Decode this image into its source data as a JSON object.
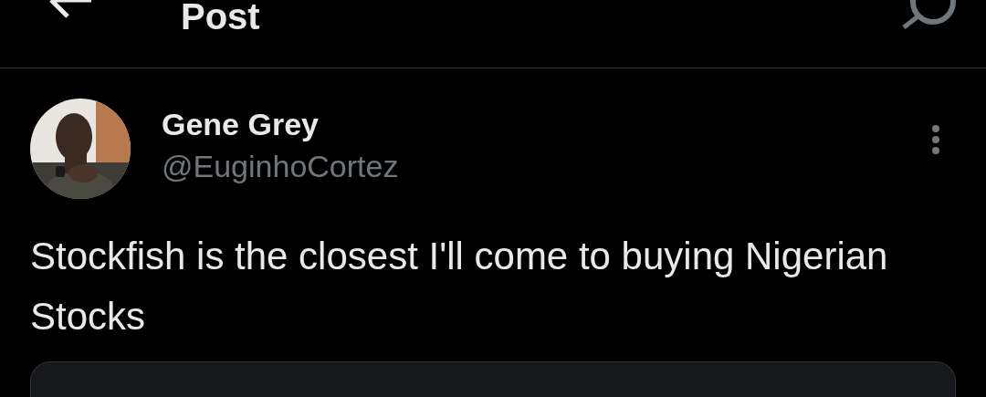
{
  "header": {
    "title": "Post"
  },
  "post": {
    "author": {
      "name": "Gene Grey",
      "handle": "@EuginhoCortez"
    },
    "text": "Stockfish is the closest I'll come to buying Nigerian Stocks",
    "card": {
      "kind": "panel"
    }
  }
}
